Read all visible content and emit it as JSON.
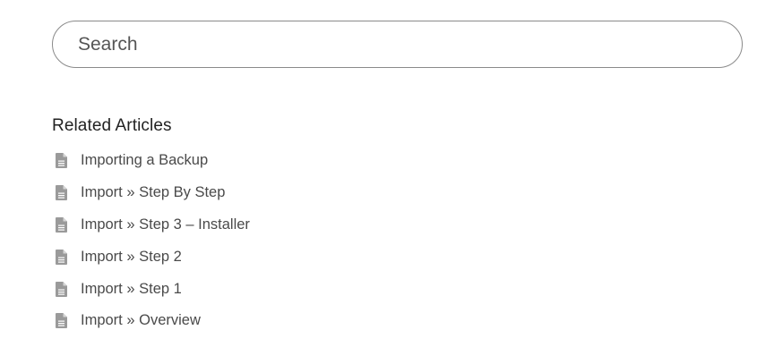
{
  "search": {
    "placeholder": "Search"
  },
  "related": {
    "title": "Related Articles",
    "items": [
      {
        "label": "Importing a Backup",
        "icon": "document-icon"
      },
      {
        "label": "Import » Step By Step",
        "icon": "document-icon"
      },
      {
        "label": "Import » Step 3 – Installer",
        "icon": "document-icon"
      },
      {
        "label": "Import » Step 2",
        "icon": "document-icon"
      },
      {
        "label": "Import » Step 1",
        "icon": "document-icon"
      },
      {
        "label": "Import » Overview",
        "icon": "document-icon"
      }
    ]
  },
  "colors": {
    "icon": "#9a9a9a",
    "link": "#4a4a4a",
    "border": "#8a8a8a"
  }
}
